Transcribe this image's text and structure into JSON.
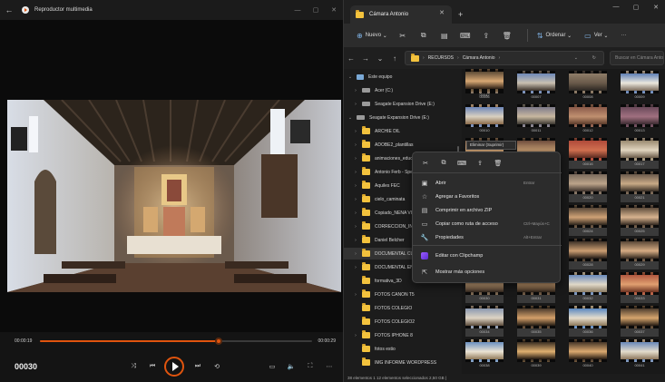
{
  "player": {
    "app_title": "Reproductor multimedia",
    "time_elapsed": "00:00:19",
    "time_total": "00:00:29",
    "progress": 0.655,
    "frame_counter": "00030",
    "accent": "#e0540e"
  },
  "explorer": {
    "tab_title": "Cámara Antonio",
    "toolbar": {
      "new_label": "Nuevo",
      "sort_label": "Ordenar",
      "view_label": "Ver",
      "more": "···"
    },
    "breadcrumb": [
      "RECURSOS",
      "Cámara Antonio"
    ],
    "search_placeholder": "Buscar en Cámara Antonio",
    "nav_items": [
      {
        "label": "Este equipo",
        "kind": "device",
        "chev": "⌄",
        "indent": 1
      },
      {
        "label": "Acer (C:)",
        "kind": "drive",
        "chev": "›",
        "indent": 2
      },
      {
        "label": "Seagate Expansion Drive (E:)",
        "kind": "drive",
        "chev": "›",
        "indent": 2
      },
      {
        "label": "Seagate Expansion Drive (E:)",
        "kind": "drive",
        "chev": "⌄",
        "indent": 1
      },
      {
        "label": "ARCHIE DIL",
        "kind": "folder",
        "chev": "›",
        "indent": 2
      },
      {
        "label": "ADOBE2_plantillas",
        "kind": "folder",
        "chev": "›",
        "indent": 2
      },
      {
        "label": "animaciones_educativas",
        "kind": "folder",
        "chev": "›",
        "indent": 2
      },
      {
        "label": "Antonio Ferb - Specto",
        "kind": "folder",
        "chev": "›",
        "indent": 2
      },
      {
        "label": "Aquiles FEC",
        "kind": "folder",
        "chev": "›",
        "indent": 2
      },
      {
        "label": "cielo_caminata",
        "kind": "folder",
        "chev": "›",
        "indent": 2
      },
      {
        "label": "Copiado_NENA VIDEOS",
        "kind": "folder",
        "chev": "›",
        "indent": 2
      },
      {
        "label": "CORRECCION_INFOGRAFIA",
        "kind": "folder",
        "chev": "›",
        "indent": 2
      },
      {
        "label": "Daniel Belcher",
        "kind": "folder",
        "chev": "›",
        "indent": 2
      },
      {
        "label": "DOCUMENTAL CUATRO",
        "kind": "folder",
        "chev": "›",
        "indent": 2,
        "selected": true
      },
      {
        "label": "DOCUMENTAL ENRIQUE",
        "kind": "folder",
        "chev": "›",
        "indent": 2
      },
      {
        "label": "formativa_3D",
        "kind": "folder",
        "chev": "",
        "indent": 2
      },
      {
        "label": "FOTOS CANON T5",
        "kind": "folder",
        "chev": "›",
        "indent": 2
      },
      {
        "label": "FOTOS COLEGIO",
        "kind": "folder",
        "chev": "",
        "indent": 2
      },
      {
        "label": "FOTOS COLEGIO2",
        "kind": "folder",
        "chev": "",
        "indent": 2
      },
      {
        "label": "FOTOS IPHONE 8",
        "kind": "folder",
        "chev": "›",
        "indent": 2
      },
      {
        "label": "fotos estio",
        "kind": "folder",
        "chev": "",
        "indent": 2
      },
      {
        "label": "IMG INFORME WORDPRESS",
        "kind": "folder",
        "chev": "",
        "indent": 2
      }
    ],
    "thumbnails": [
      {
        "name": "00006",
        "colors": [
          "#7a6a5a",
          "#bfa68a",
          "#3b3a44"
        ]
      },
      {
        "name": "00007",
        "colors": [
          "#6e88b8",
          "#c9c0b0",
          "#3a3028"
        ]
      },
      {
        "name": "00008",
        "colors": [
          "#8f7d68",
          "#6a5a4a",
          "#2a2622"
        ]
      },
      {
        "name": "00009",
        "colors": [
          "#5e7fb5",
          "#ebe7dd",
          "#7a6a5a"
        ]
      },
      {
        "name": "00010",
        "colors": [
          "#6d86b8",
          "#d9d0c0",
          "#8a6a4a"
        ]
      },
      {
        "name": "00011",
        "colors": [
          "#7d7a8a",
          "#c8b8a0",
          "#3a3630"
        ]
      },
      {
        "name": "00012",
        "colors": [
          "#8a5a4a",
          "#c09070",
          "#5a3a2a"
        ]
      },
      {
        "name": "00013",
        "colors": [
          "#6a4a5a",
          "#a07080",
          "#3a2a30"
        ]
      },
      {
        "name": "00014",
        "colors": [
          "#8a6a52",
          "#d4a676",
          "#3c2e22"
        ]
      },
      {
        "name": "00015",
        "colors": [
          "#6c4c3c",
          "#c49a70",
          "#2e2218"
        ]
      },
      {
        "name": "00016",
        "colors": [
          "#b04a3a",
          "#d07050",
          "#5a2a20"
        ]
      },
      {
        "name": "00017",
        "colors": [
          "#9a8a70",
          "#e2d6c0",
          "#6a5a48"
        ]
      },
      {
        "name": "00018",
        "colors": [
          "#4a4038",
          "#d6b490",
          "#2a2420"
        ]
      },
      {
        "name": "00019",
        "colors": [
          "#5a4a3c",
          "#caa682",
          "#2c241e"
        ]
      },
      {
        "name": "00020",
        "colors": [
          "#7a6a5c",
          "#bca48a",
          "#3a302a"
        ]
      },
      {
        "name": "00021",
        "colors": [
          "#6a5a4c",
          "#c8aa86",
          "#342a22"
        ]
      },
      {
        "name": "00022",
        "colors": [
          "#3c3028",
          "#d8b080",
          "#201a16"
        ]
      },
      {
        "name": "00023",
        "colors": [
          "#4a3a30",
          "#d4a878",
          "#261e18"
        ]
      },
      {
        "name": "00024",
        "colors": [
          "#574738",
          "#cfa276",
          "#2a221a"
        ]
      },
      {
        "name": "00025",
        "colors": [
          "#5e4c3c",
          "#d8b490",
          "#30261e"
        ]
      },
      {
        "name": "00026",
        "colors": [
          "#443630",
          "#c89a70",
          "#221a16"
        ]
      },
      {
        "name": "00027",
        "colors": [
          "#4c3e32",
          "#d2aa80",
          "#281e18"
        ]
      },
      {
        "name": "00028",
        "colors": [
          "#3e3228",
          "#cc9e72",
          "#201814"
        ]
      },
      {
        "name": "00029",
        "colors": [
          "#5a4838",
          "#d6ac84",
          "#2e241c"
        ]
      },
      {
        "name": "00030",
        "colors": [
          "#6b5a48",
          "#c9a27a",
          "#2e241c"
        ]
      },
      {
        "name": "00031",
        "colors": [
          "#5c4a3a",
          "#c89c70",
          "#2a2018"
        ]
      },
      {
        "name": "00032",
        "colors": [
          "#6a8aba",
          "#e0d8c8",
          "#8a7a62"
        ]
      },
      {
        "name": "00033",
        "colors": [
          "#b05840",
          "#e0a070",
          "#6a3020"
        ]
      },
      {
        "name": "00034",
        "colors": [
          "#8a98b0",
          "#ded4c4",
          "#5a4a3a"
        ]
      },
      {
        "name": "00035",
        "colors": [
          "#4a3a2c",
          "#d4a06a",
          "#221a12"
        ]
      },
      {
        "name": "00036",
        "colors": [
          "#5a88c0",
          "#e6ddcc",
          "#8a7658"
        ]
      },
      {
        "name": "00037",
        "colors": [
          "#4c3c2e",
          "#d6a66e",
          "#241a12"
        ]
      },
      {
        "name": "00038",
        "colors": [
          "#6a90c0",
          "#ece4d4",
          "#907a5a"
        ]
      },
      {
        "name": "00039",
        "colors": [
          "#3a2e22",
          "#e0b070",
          "#1e1610"
        ]
      },
      {
        "name": "00040",
        "colors": [
          "#463628",
          "#dcaa70",
          "#221810"
        ]
      },
      {
        "name": "00041",
        "colors": [
          "#6888b8",
          "#e4dccc",
          "#8c765c"
        ]
      },
      {
        "name": "00042",
        "colors": [
          "#5c4a36",
          "#d8a874",
          "#2a1e14"
        ]
      }
    ],
    "tooltip": "Eliminar (Suprimir)",
    "status": "38 elementos   1   12 elementos seleccionados   2,50 GB   |"
  },
  "context_menu": {
    "icon_row": [
      "cut-icon",
      "copy-icon",
      "rename-icon",
      "share-icon",
      "delete-icon"
    ],
    "items": [
      {
        "label": "Abrir",
        "shortcut": "Entrar",
        "icon": "open-icon"
      },
      {
        "label": "Agregar a Favoritos",
        "shortcut": "",
        "icon": "star-icon"
      },
      {
        "label": "Comprimir en archivo ZIP",
        "shortcut": "",
        "icon": "zip-icon"
      },
      {
        "label": "Copiar como ruta de acceso",
        "shortcut": "Ctrl+Mayús+C",
        "icon": "path-icon"
      },
      {
        "label": "Propiedades",
        "shortcut": "Alt+Entrar",
        "icon": "wrench-icon"
      },
      {
        "label": "Editar con Clipchamp",
        "shortcut": "",
        "icon": "clipchamp-icon"
      },
      {
        "label": "Mostrar más opciones",
        "shortcut": "",
        "icon": "more-options-icon"
      }
    ]
  }
}
